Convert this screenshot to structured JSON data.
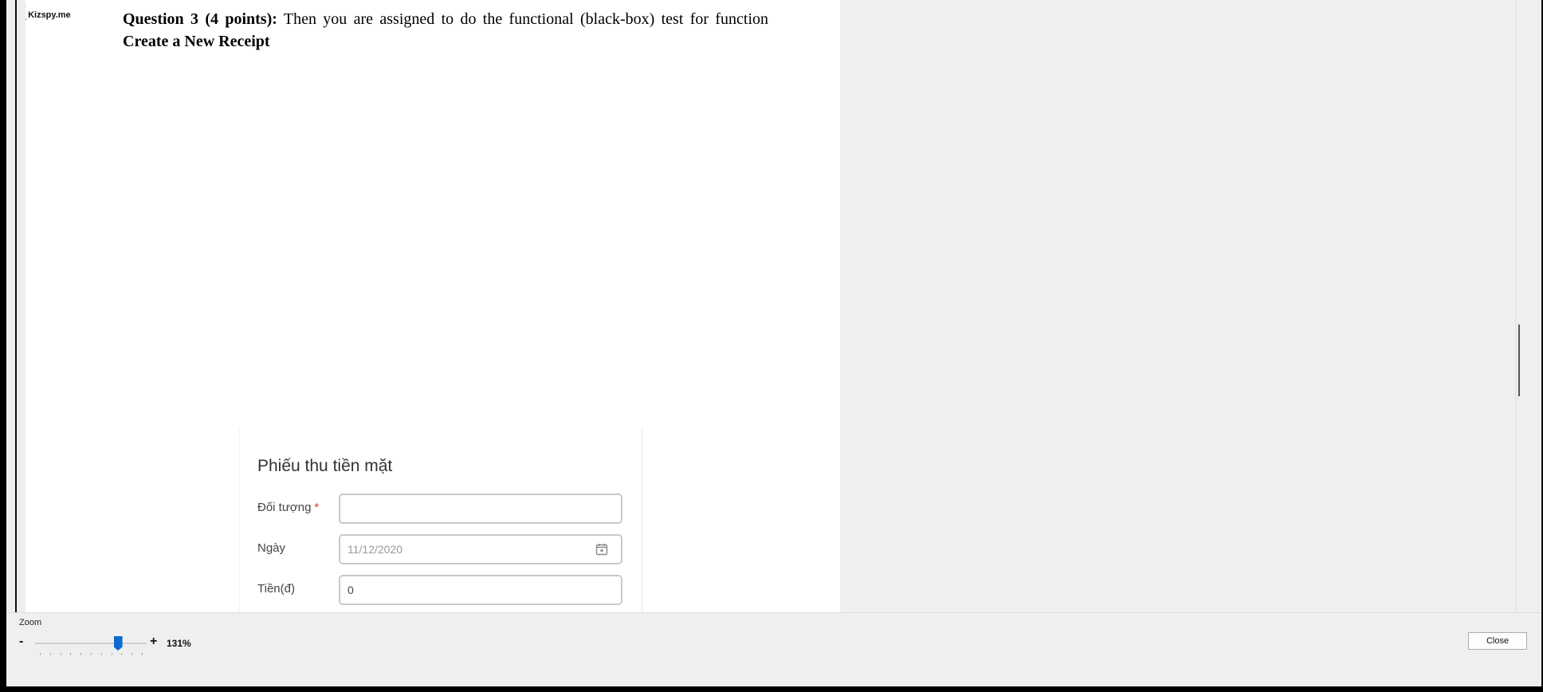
{
  "logo": {
    "mark": "K",
    "text": "Kizspy.me",
    "brand_color": "#e0262b"
  },
  "document": {
    "question_heading": "Question 3 (4 points):",
    "question_text": " Then you are assigned to do the functional (black-box) test for function",
    "question_line2": "Create a New Receipt"
  },
  "form": {
    "title": "Phiếu thu tiền mặt",
    "fields": [
      {
        "label": "Đối tượng",
        "required_mark": "*",
        "value": "",
        "placeholder": ""
      },
      {
        "label": "Ngày",
        "value": "",
        "placeholder": "11/12/2020",
        "icon": "calendar-icon"
      },
      {
        "label": "Tiền(đ)",
        "value": "0"
      }
    ]
  },
  "zoom": {
    "label": "Zoom",
    "minus": "-",
    "plus": "+",
    "value_text": "131%",
    "slider_fraction": 0.74,
    "accent_color": "#0b6cce"
  },
  "actions": {
    "close_label": "Close"
  }
}
